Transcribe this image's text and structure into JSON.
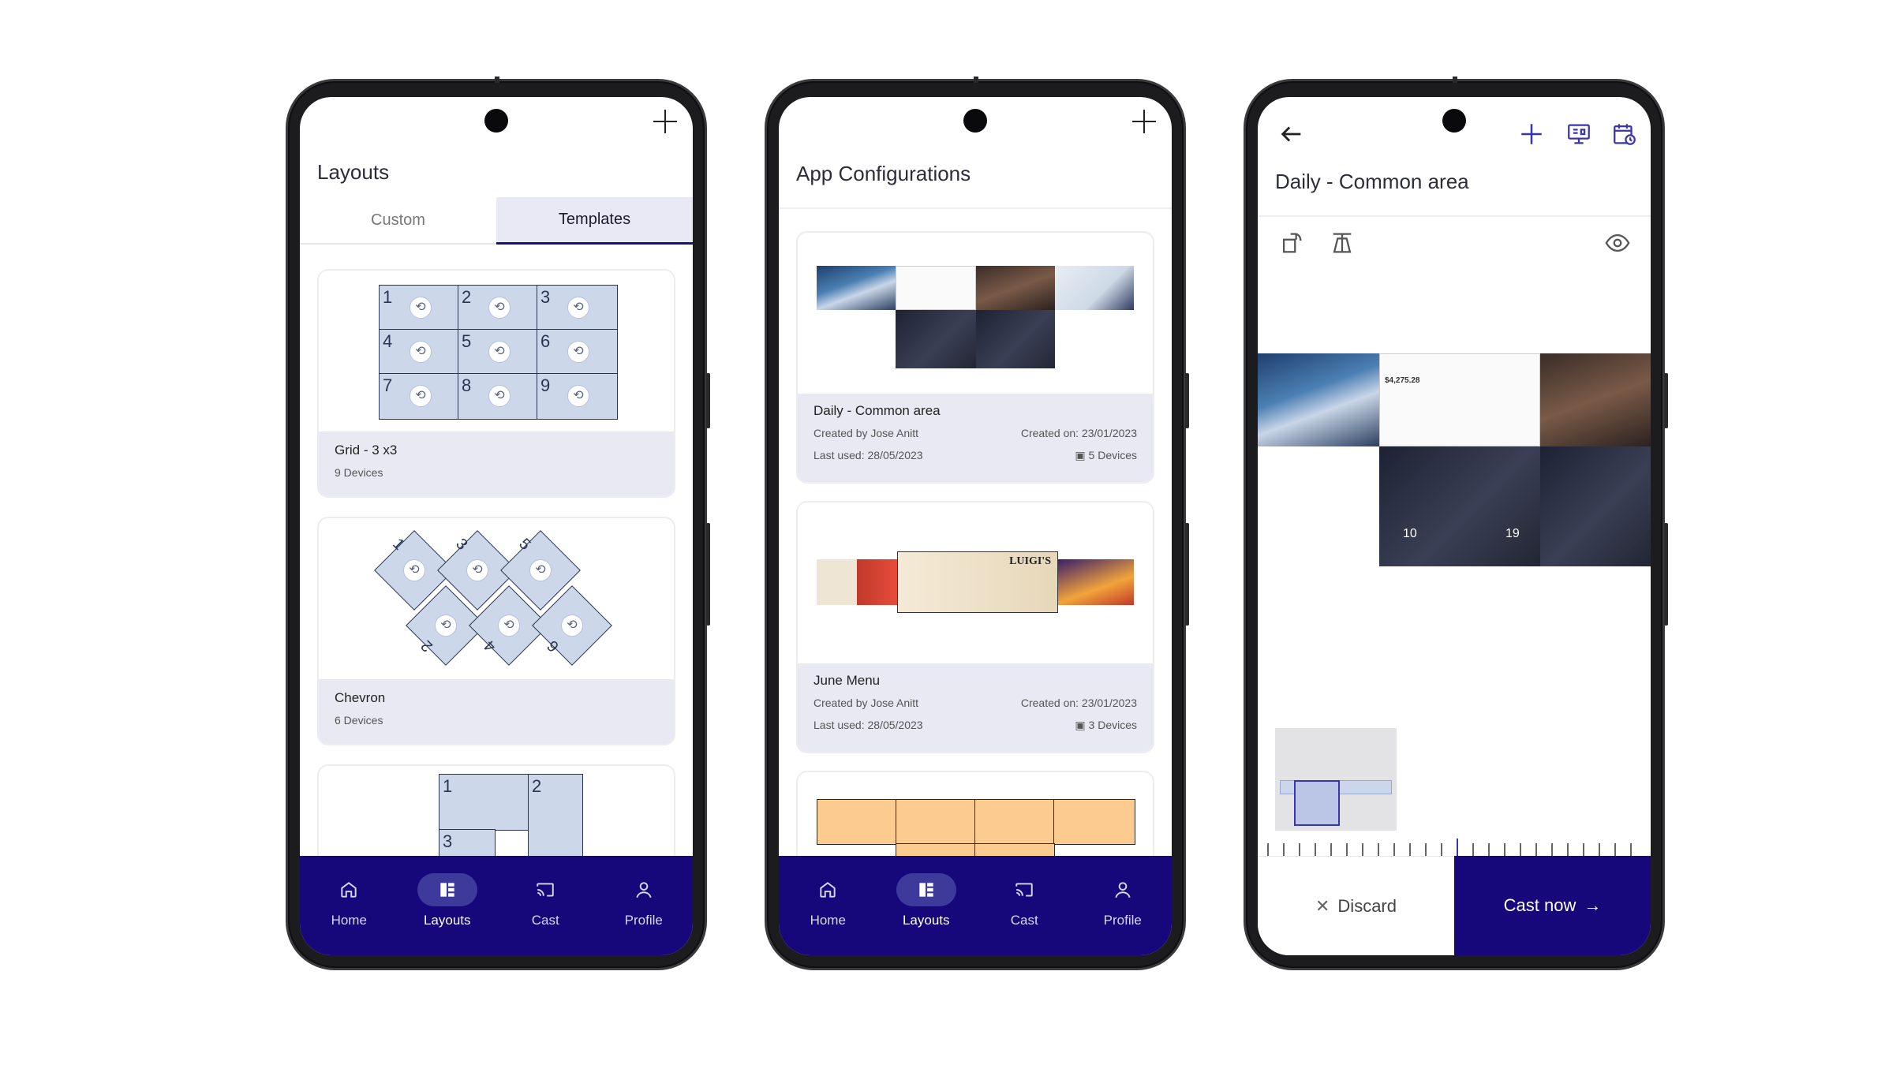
{
  "screen1": {
    "title": "Layouts",
    "tabs": [
      {
        "label": "Custom",
        "active": false
      },
      {
        "label": "Templates",
        "active": true
      }
    ],
    "cards": [
      {
        "name": "Grid - 3 x3",
        "devices": "9 Devices",
        "cells": [
          "1",
          "2",
          "3",
          "4",
          "5",
          "6",
          "7",
          "8",
          "9"
        ]
      },
      {
        "name": "Chevron",
        "devices": "6 Devices",
        "cells": [
          "1",
          "3",
          "5",
          "2",
          "4",
          "6"
        ]
      },
      {
        "cells": [
          "1",
          "2",
          "3"
        ]
      }
    ]
  },
  "screen2": {
    "title": "App Configurations",
    "cards": [
      {
        "name": "Daily - Common area",
        "created_by": "Created by Jose Anitt",
        "created_on": "Created on: 23/01/2023",
        "last_used": "Last used: 28/05/2023",
        "devices": "5 Devices"
      },
      {
        "name": "June Menu",
        "created_by": "Created by Jose Anitt",
        "created_on": "Created on: 23/01/2023",
        "last_used": "Last used: 28/05/2023",
        "devices": "3 Devices",
        "menu_title": "LUIGI'S"
      }
    ]
  },
  "screen3": {
    "title": "Daily - Common area",
    "discard": "Discard",
    "cast_now": "Cast now",
    "thumb_texts": [
      "$4,275.28",
      "10",
      "19"
    ]
  },
  "nav": [
    {
      "label": "Home",
      "icon": "home-icon"
    },
    {
      "label": "Layouts",
      "icon": "layouts-icon"
    },
    {
      "label": "Cast",
      "icon": "cast-icon"
    },
    {
      "label": "Profile",
      "icon": "profile-icon"
    }
  ],
  "colors": {
    "primary": "#16087a",
    "accent_cell": "#ccd7ea",
    "orange_cell": "#fccb8f"
  }
}
